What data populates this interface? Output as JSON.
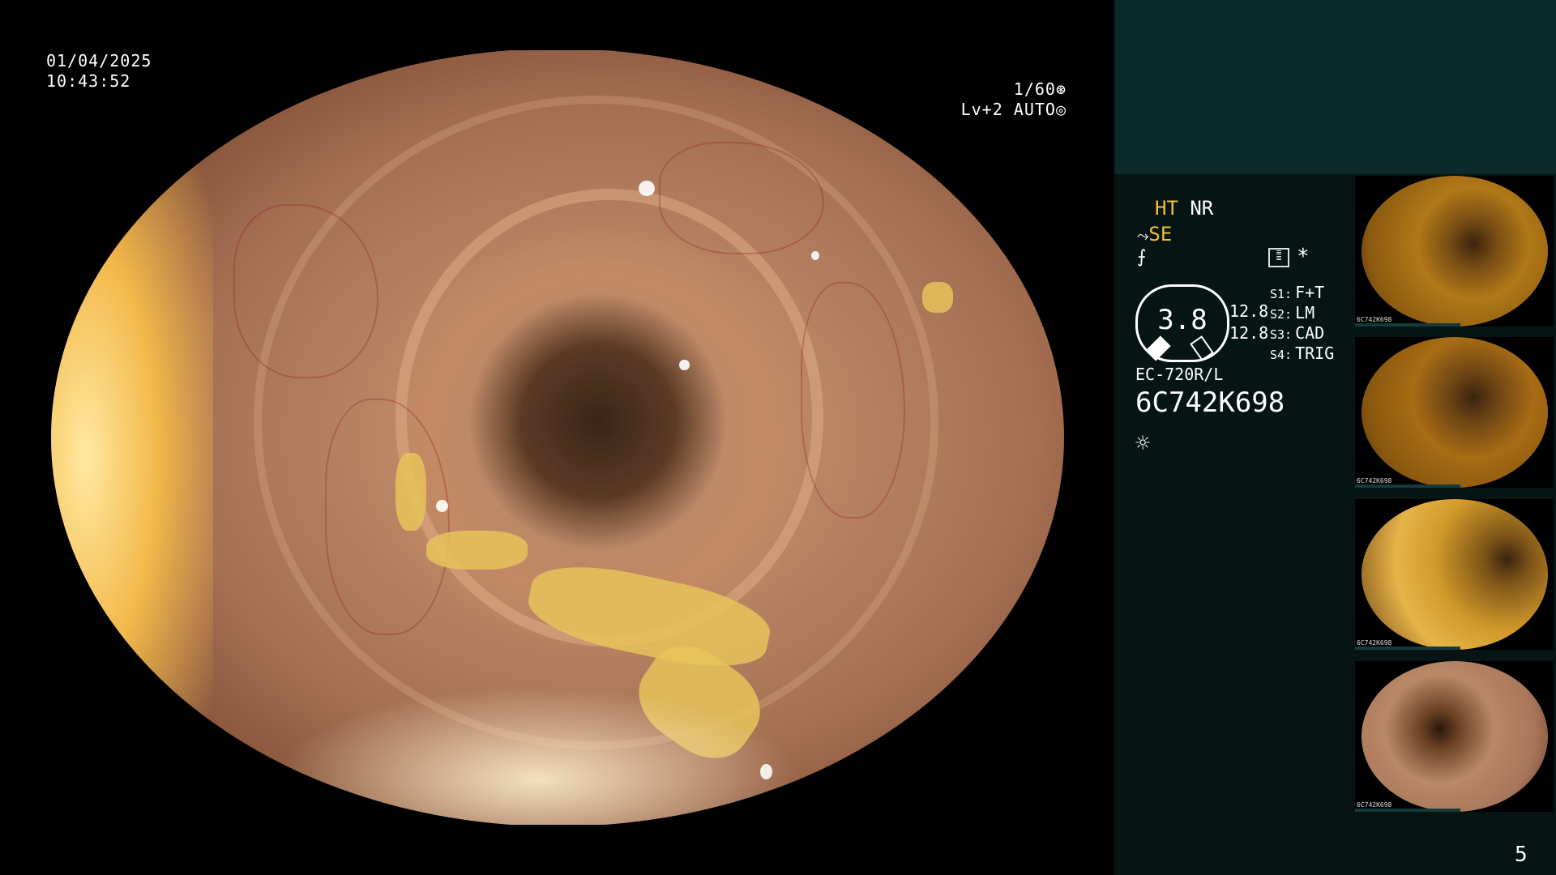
{
  "overlay": {
    "date": "01/04/2025",
    "time": "10:43:52",
    "shutter": "1/60",
    "shutter_icon": "aperture-icon",
    "level": "Lv+2 AUTO",
    "level_icon": "auto-iris-icon"
  },
  "info": {
    "ht": "HT",
    "nr": "NR",
    "se": "SE",
    "se_icon": "structure-enhance-icon",
    "ff_icon": "freeze-icon",
    "menu_icon": "menu-icon",
    "asterisk": "*",
    "gauge_value": "3.8",
    "value_1": "12.8",
    "value_2": "12.8",
    "switches": [
      {
        "key": "S1:",
        "value": "F+T"
      },
      {
        "key": "S2:",
        "value": "LM"
      },
      {
        "key": "S3:",
        "value": "CAD"
      },
      {
        "key": "S4:",
        "value": "TRIG"
      }
    ],
    "scope_model": "EC-720R/L",
    "scope_serial": "6C742K698",
    "light_icon": "sun-icon",
    "page_number": "5"
  },
  "thumbnails": [
    {
      "label": "6C742K698",
      "tone": "#b07818"
    },
    {
      "label": "6C742K698",
      "tone": "#a86c14"
    },
    {
      "label": "6C742K698",
      "tone": "#d29a2a"
    },
    {
      "label": "6C742K698",
      "tone": "#b98866"
    }
  ],
  "colors": {
    "accent_yellow": "#f1c232",
    "panel_dark": "#061414",
    "panel_top": "#0c2a2a"
  }
}
